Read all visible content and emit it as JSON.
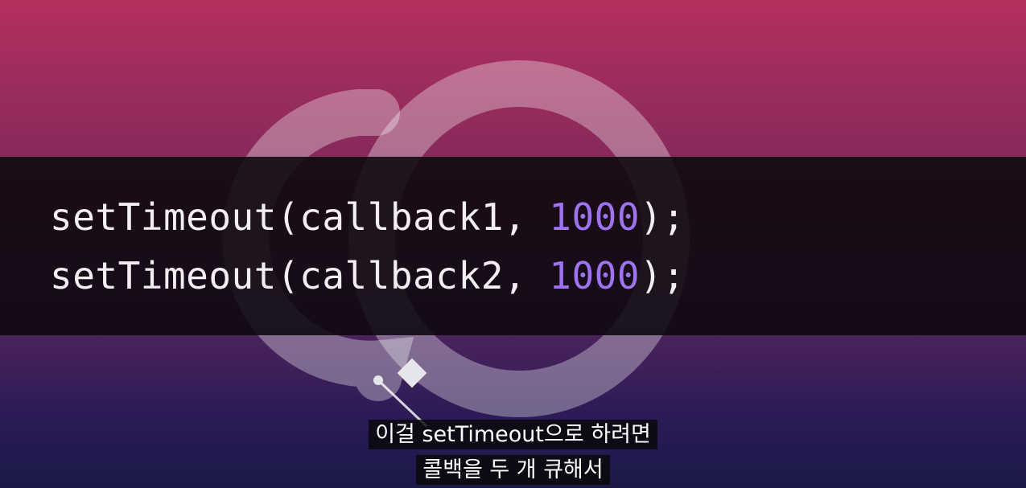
{
  "code": {
    "lines": [
      {
        "prefix": "setTimeout(callback1, ",
        "number": "1000",
        "suffix": ");"
      },
      {
        "prefix": "setTimeout(callback2, ",
        "number": "1000",
        "suffix": ");"
      }
    ],
    "number_color": "#9f73f0"
  },
  "subtitles": {
    "line1": "이걸 setTimeout으로 하려면",
    "line2": "콜백을 두 개 큐해서"
  },
  "background": {
    "logo_icon": "event-loop-ring-icon",
    "gradient_top": "#b42f5e",
    "gradient_bottom": "#1b1948"
  }
}
